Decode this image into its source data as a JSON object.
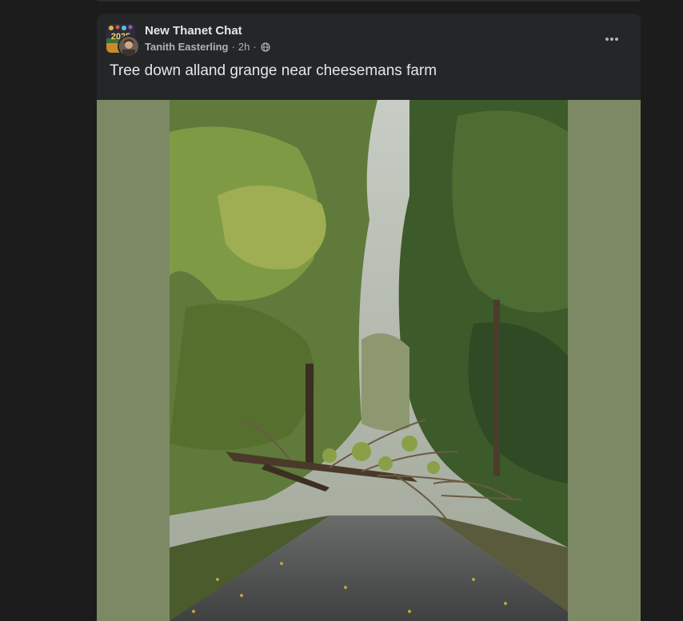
{
  "post": {
    "group_name": "New Thanet Chat",
    "author": "Tanith Easterling",
    "separator": "·",
    "time": "2h",
    "audience_icon": "globe-icon",
    "more_icon": "more-options-icon",
    "text": "Tree down alland grange near cheesemans farm",
    "avatar_text": "2025"
  },
  "photo": {
    "subject": "fallen-tree-on-lane",
    "letterbox_color": "#7d8965"
  },
  "colors": {
    "page_bg": "#1c1c1d",
    "card_bg": "#252628",
    "text_primary": "#e4e6eb",
    "text_secondary": "#b0b3b8"
  }
}
